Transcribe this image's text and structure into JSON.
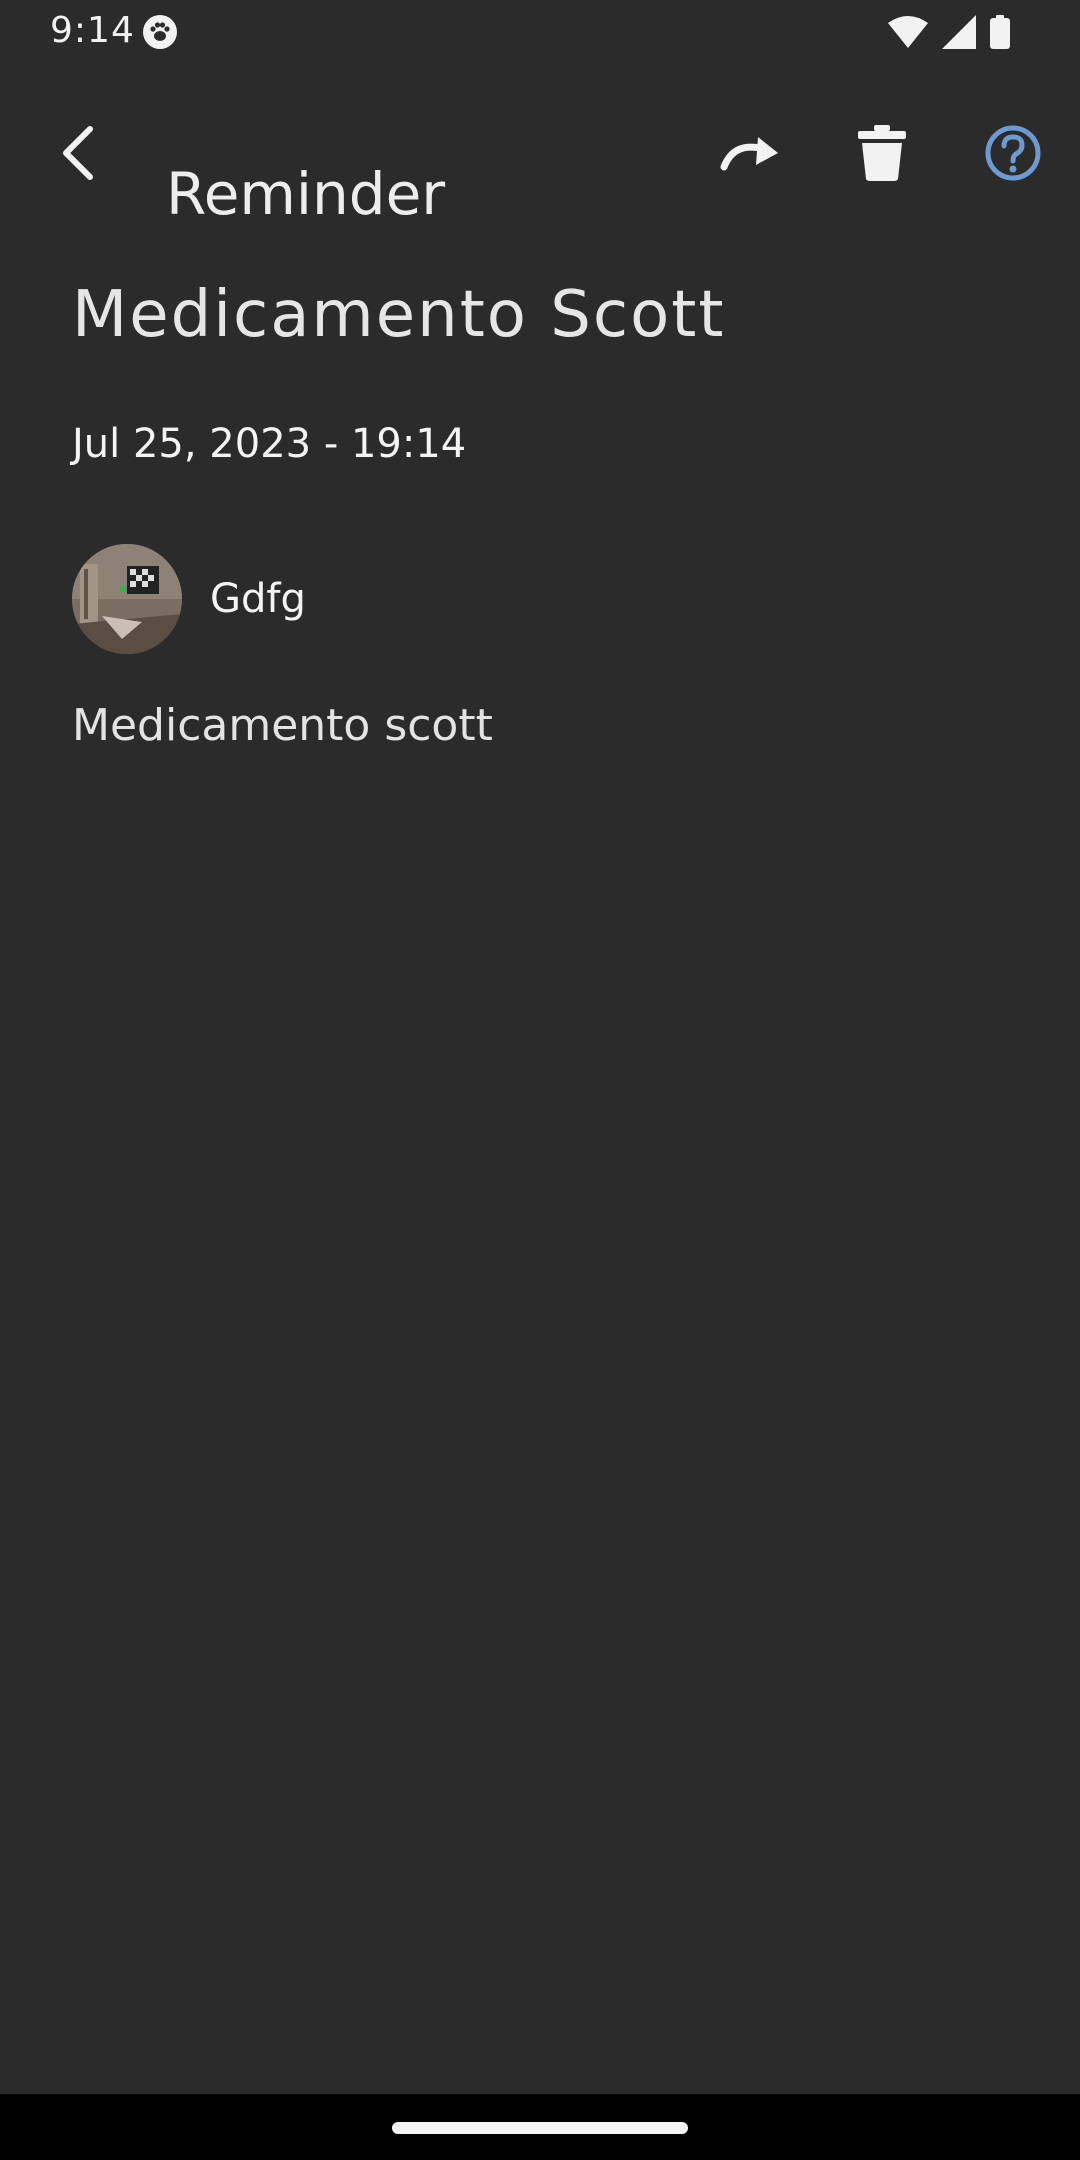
{
  "status_bar": {
    "time": "9:14",
    "icons": [
      "paw-icon",
      "wifi-icon",
      "cellular-signal-icon",
      "battery-icon"
    ]
  },
  "app_bar": {
    "title": "Reminder",
    "back_icon": "chevron-left-icon",
    "actions": [
      "forward-arrow-icon",
      "trash-icon",
      "help-circle-icon"
    ],
    "help_color": "#6c9bd2"
  },
  "reminder": {
    "title": "Medicamento Scott",
    "datetime": "Jul 25, 2023 - 19:14",
    "contact_name": "Gdfg",
    "note": "Medicamento scott"
  },
  "colors": {
    "background": "#2b2b2b",
    "nav_bar": "#000000"
  }
}
